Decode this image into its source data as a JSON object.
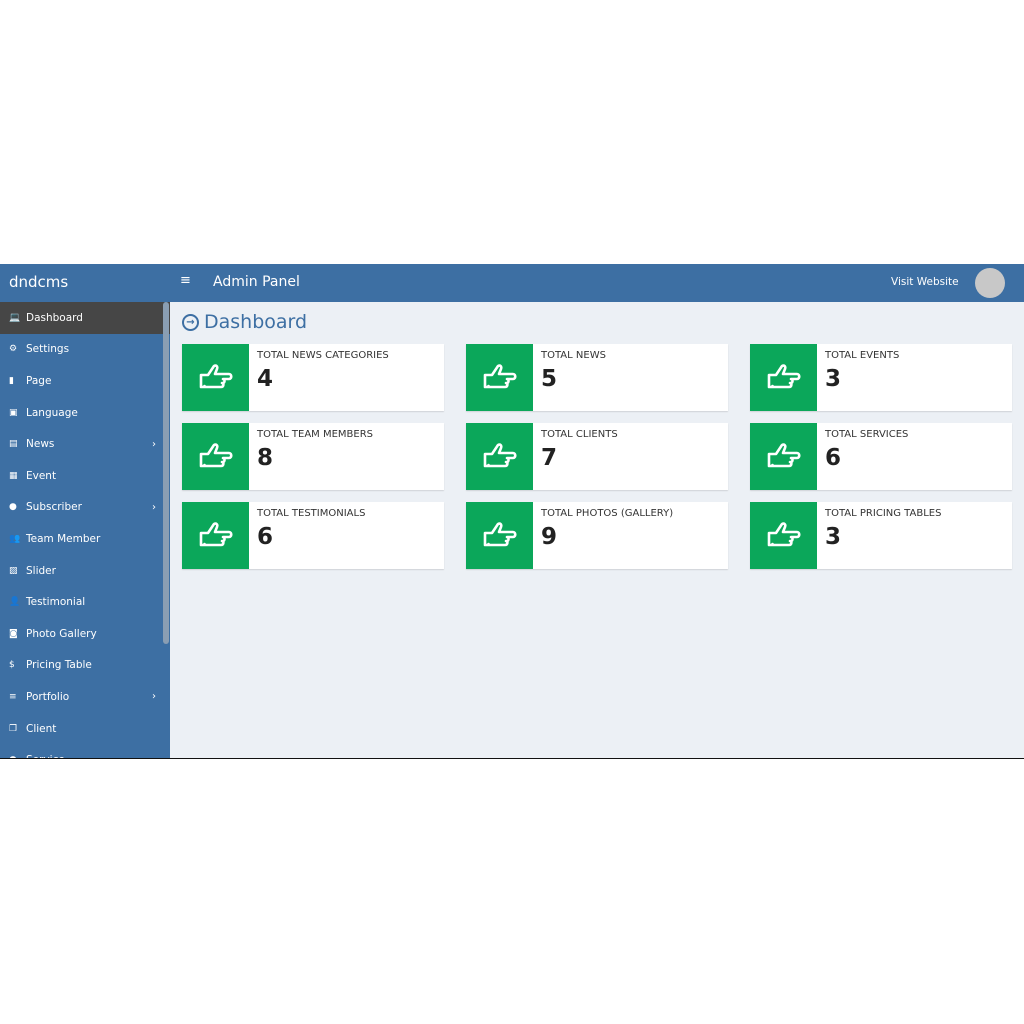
{
  "header": {
    "brand": "dndcms",
    "title": "Admin Panel",
    "visit": "Visit Website"
  },
  "sidebar": {
    "items": [
      {
        "label": "Dashboard",
        "icon": "laptop-icon",
        "glyph": "💻",
        "active": true
      },
      {
        "label": "Settings",
        "icon": "gear-icon",
        "glyph": "⚙"
      },
      {
        "label": "Page",
        "icon": "file-icon",
        "glyph": "▮"
      },
      {
        "label": "Language",
        "icon": "language-icon",
        "glyph": "▣"
      },
      {
        "label": "News",
        "icon": "newspaper-icon",
        "glyph": "▤",
        "sub": true
      },
      {
        "label": "Event",
        "icon": "calendar-icon",
        "glyph": "▦"
      },
      {
        "label": "Subscriber",
        "icon": "comment-icon",
        "glyph": "●",
        "sub": true
      },
      {
        "label": "Team Member",
        "icon": "users-icon",
        "glyph": "👥"
      },
      {
        "label": "Slider",
        "icon": "image-icon",
        "glyph": "▨"
      },
      {
        "label": "Testimonial",
        "icon": "user-plus-icon",
        "glyph": "👤"
      },
      {
        "label": "Photo Gallery",
        "icon": "camera-icon",
        "glyph": "◙"
      },
      {
        "label": "Pricing Table",
        "icon": "dollar-icon",
        "glyph": "$"
      },
      {
        "label": "Portfolio",
        "icon": "bars-icon",
        "glyph": "≡",
        "sub": true
      },
      {
        "label": "Client",
        "icon": "copy-icon",
        "glyph": "❐"
      },
      {
        "label": "Service",
        "icon": "service-icon",
        "glyph": "●"
      }
    ]
  },
  "page": {
    "title": "Dashboard"
  },
  "cards": [
    {
      "label": "TOTAL NEWS CATEGORIES",
      "value": "4"
    },
    {
      "label": "TOTAL NEWS",
      "value": "5"
    },
    {
      "label": "TOTAL EVENTS",
      "value": "3"
    },
    {
      "label": "TOTAL TEAM MEMBERS",
      "value": "8"
    },
    {
      "label": "TOTAL CLIENTS",
      "value": "7"
    },
    {
      "label": "TOTAL SERVICES",
      "value": "6"
    },
    {
      "label": "TOTAL TESTIMONIALS",
      "value": "6"
    },
    {
      "label": "TOTAL PHOTOS (GALLERY)",
      "value": "9"
    },
    {
      "label": "TOTAL PRICING TABLES",
      "value": "3"
    }
  ],
  "colors": {
    "primary": "#3d6fa3",
    "green": "#0ba75a",
    "bg": "#ecf0f5"
  }
}
